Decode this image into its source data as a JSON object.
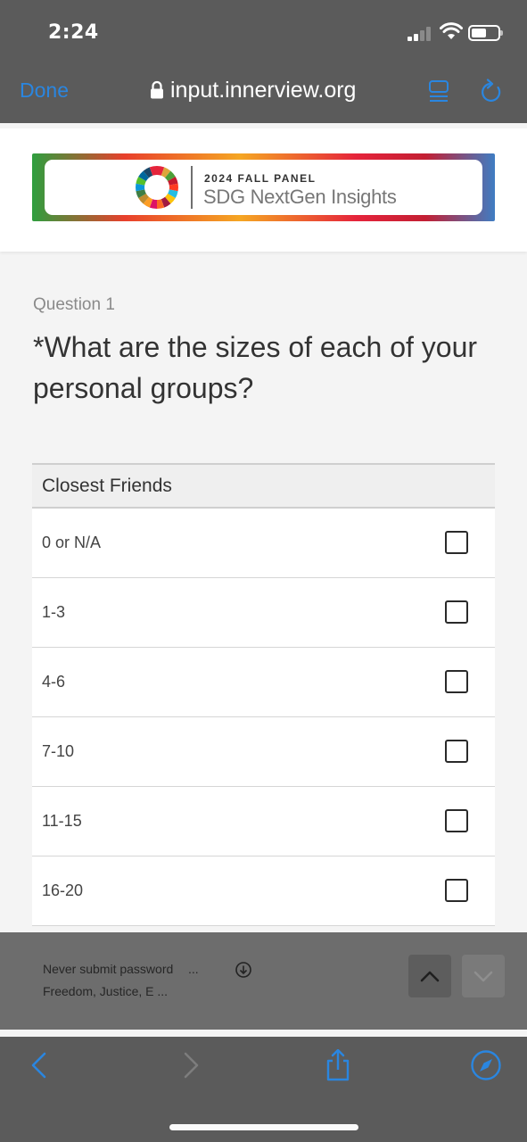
{
  "status_bar": {
    "time": "2:24"
  },
  "browser": {
    "done_label": "Done",
    "url": "input.innerview.org"
  },
  "banner": {
    "kicker": "2024 FALL PANEL",
    "title": "SDG NextGen Insights"
  },
  "question": {
    "number_label": "Question 1",
    "text": "*What are the sizes of each of your personal groups?"
  },
  "table": {
    "header": "Closest Friends",
    "rows": [
      {
        "label": "0 or N/A",
        "checked": false
      },
      {
        "label": "1-3",
        "checked": false
      },
      {
        "label": "4-6",
        "checked": false
      },
      {
        "label": "7-10",
        "checked": false
      },
      {
        "label": "11-15",
        "checked": false
      },
      {
        "label": "16-20",
        "checked": false
      }
    ]
  },
  "autofill": {
    "suggestion_1": "Never submit password",
    "suggestion_1_more": "...",
    "suggestion_2": "Freedom, Justice, E ..."
  },
  "colors": {
    "accent": "#2a86e0",
    "chrome": "#5b5b5b"
  },
  "icons": [
    "lock-icon",
    "reader-mode-icon",
    "reload-icon",
    "down-circle-icon",
    "chevron-up-icon",
    "chevron-down-icon",
    "back-icon",
    "forward-icon",
    "share-icon",
    "compass-icon"
  ]
}
